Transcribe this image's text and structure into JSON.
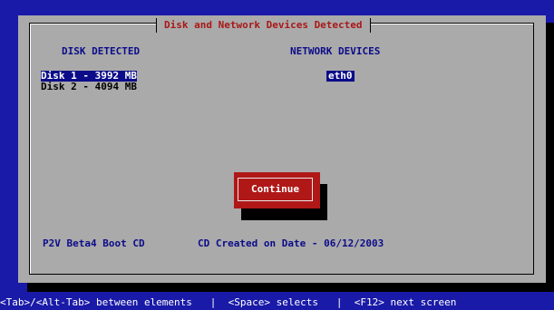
{
  "dialog": {
    "title": "Disk and Network Devices Detected",
    "disk_header": "DISK DETECTED",
    "network_header": "NETWORK DEVICES",
    "disks": [
      "Disk 1 - 3992 MB",
      "Disk 2 - 4094 MB"
    ],
    "network_devices": [
      "eth0"
    ],
    "continue_label": "Continue",
    "boot_cd_label": "P2V Beta4 Boot CD",
    "created_label": "CD Created on Date - 06/12/2003"
  },
  "hint_bar": "<Tab>/<Alt-Tab> between elements   |  <Space> selects   |  <F12> next screen",
  "colors": {
    "background": "#1a1aa8",
    "dialog": "#aaaaaa",
    "accent": "#aa1818",
    "selection": "#0c0c8a"
  }
}
